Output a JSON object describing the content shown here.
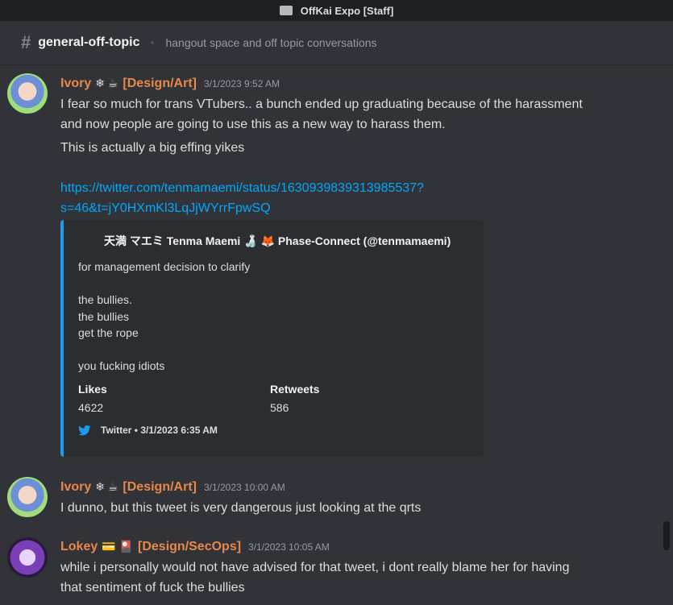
{
  "window": {
    "title": "OffKai Expo [Staff]"
  },
  "channel": {
    "name": "general-off-topic",
    "topic": "hangout space and off topic conversations"
  },
  "messages": [
    {
      "username": "Ivory",
      "badges": "❄ ☕",
      "role": "[Design/Art]",
      "timestamp": "3/1/2023 9:52 AM",
      "lines": [
        "I fear so much for trans VTubers.. a bunch ended up graduating because of the harassment",
        "and now people are going to use this as a new way to harass them.",
        "This is actually a big effing yikes"
      ],
      "link_line1": "https://twitter.com/tenmamaemi/status/1630939839313985537?",
      "link_line2": "s=46&t=jY0HXmKl3LqJjWYrrFpwSQ",
      "embed": {
        "author": "天満 マエミ Tenma Maemi 🍶 🦊 Phase-Connect (@tenmamaemi)",
        "description": [
          "for management decision to clarify",
          "",
          "the bullies.",
          "the bullies",
          "get the rope",
          "",
          "you fucking idiots"
        ],
        "likes_label": "Likes",
        "likes_value": "4622",
        "retweets_label": "Retweets",
        "retweets_value": "586",
        "footer": "Twitter • 3/1/2023 6:35 AM",
        "accent_color": "#1d9bf0"
      }
    },
    {
      "username": "Ivory",
      "badges": "❄ ☕",
      "role": "[Design/Art]",
      "timestamp": "3/1/2023 10:00 AM",
      "lines": [
        "I dunno, but this tweet is very dangerous just looking at the qrts"
      ]
    },
    {
      "username": "Lokey",
      "badges": "💳 🎴",
      "role": "[Design/SecOps]",
      "timestamp": "3/1/2023 10:05 AM",
      "lines": [
        "while i personally would not have advised for that tweet, i dont really blame her for having",
        "that sentiment of fuck the bullies"
      ]
    }
  ],
  "colors": {
    "background": "#313338",
    "username": "#e8874a",
    "link": "#00a8fc"
  }
}
